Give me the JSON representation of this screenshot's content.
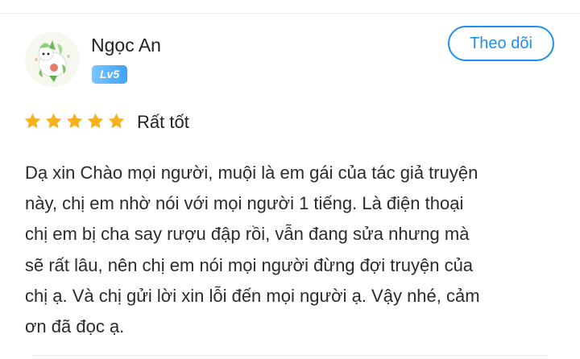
{
  "user": {
    "name": "Ngọc An",
    "level": "Lv5",
    "follow_label": "Theo dõi"
  },
  "rating": {
    "stars": 5,
    "max_stars": 5,
    "label": "Rất tốt",
    "star_color": "#f7b21b"
  },
  "review": {
    "lines": [
      "Dạ xin Chào mọi người, muội là em gái của tác giả truyện",
      "này, chị em nhờ nói với mọi người 1 tiếng. Là điện thoại",
      "chị em bị cha say rượu đập rồi, vẫn đang sửa nhưng mà",
      "sẽ rất lâu, nên chị em nói mọi người đừng đợi truyện của",
      "chị ạ. Và chị gửi lời xin lỗi đến mọi người ạ. Vậy nhé, cảm",
      "ơn đã đọc ạ."
    ]
  },
  "colors": {
    "accent": "#1e90f0",
    "badge": "#3fa3f5"
  }
}
